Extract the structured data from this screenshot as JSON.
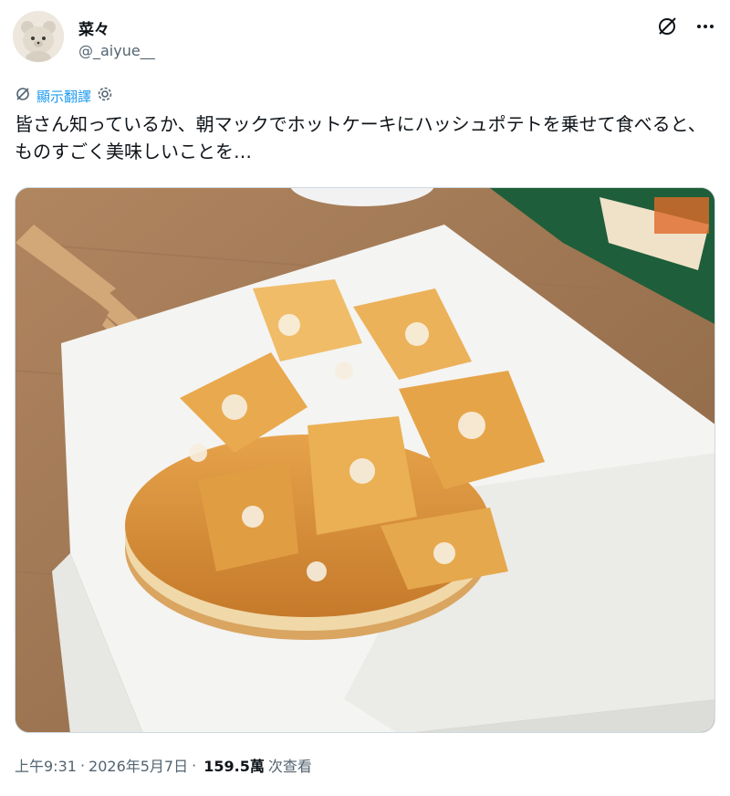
{
  "author": {
    "display_name": "菜々",
    "handle": "@_aiyue__"
  },
  "header_icons": {
    "grok": "grok-slash-icon",
    "more": "more-dots-icon"
  },
  "translate": {
    "label": "顯示翻譯",
    "icon": "translate-icon",
    "settings_icon": "gear-icon"
  },
  "tweet": {
    "text": "皆さん知っているか、朝マックでホットケーキにハッシュポテトを乗せて食べると、ものすごく美味しいことを…"
  },
  "media": {
    "subject": "photo"
  },
  "meta": {
    "time": "上午9:31",
    "date": "2026年5月7日",
    "views_count": "159.5萬",
    "views_label": "次查看"
  },
  "colors": {
    "accent": "#1d9bf0",
    "muted": "#536471",
    "text": "#0f1419"
  }
}
